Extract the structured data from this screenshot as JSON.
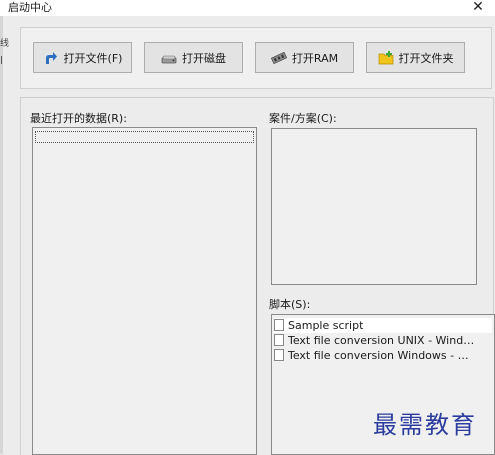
{
  "window": {
    "title": "启动中心",
    "close_glyph": "✕"
  },
  "toolbar": {
    "buttons": [
      {
        "label": "打开文件(F)",
        "icon": "open-arrow-icon"
      },
      {
        "label": "打开磁盘",
        "icon": "disk-icon"
      },
      {
        "label": "打开RAM",
        "icon": "ram-chip-icon"
      },
      {
        "label": "打开文件夹",
        "icon": "folder-icon"
      }
    ]
  },
  "recent": {
    "label": "最近打开的数据(R):",
    "items": []
  },
  "cases": {
    "label": "案件/方案(C):",
    "items": []
  },
  "scripts": {
    "label": "脚本(S):",
    "items": [
      {
        "name": "Sample script",
        "selected": true
      },
      {
        "name": "Text file conversion UNIX - Windo...",
        "selected": false
      },
      {
        "name": "Text file conversion Windows - U...",
        "selected": false
      }
    ]
  },
  "watermark": "最需教育",
  "leftedge_text": "线"
}
